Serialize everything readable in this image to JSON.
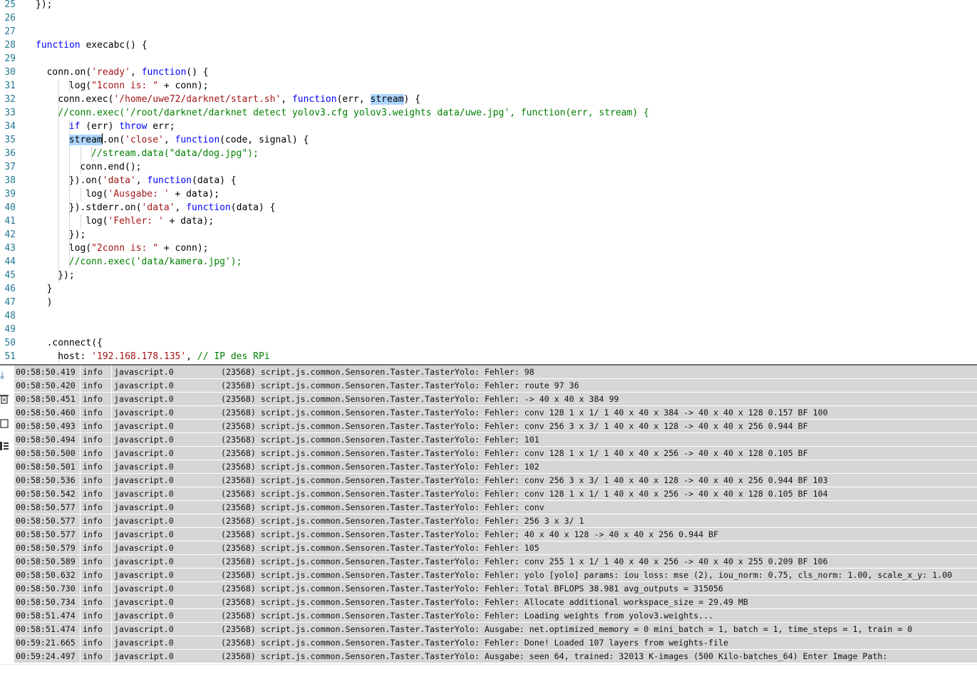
{
  "editor": {
    "lines": [
      {
        "n": "25",
        "ind": 0,
        "tokens": [
          {
            "t": "});"
          }
        ]
      },
      {
        "n": "26",
        "ind": 0,
        "tokens": []
      },
      {
        "n": "27",
        "ind": 0,
        "tokens": []
      },
      {
        "n": "28",
        "ind": 0,
        "tokens": [
          {
            "t": "function",
            "c": "kw"
          },
          {
            "t": " execabc() {"
          }
        ]
      },
      {
        "n": "29",
        "ind": 0,
        "tokens": []
      },
      {
        "n": "30",
        "ind": 2,
        "tokens": [
          {
            "t": "conn.on("
          },
          {
            "t": "'ready'",
            "c": "str"
          },
          {
            "t": ", "
          },
          {
            "t": "function",
            "c": "kw"
          },
          {
            "t": "() {"
          }
        ]
      },
      {
        "n": "31",
        "ind": 6,
        "tokens": [
          {
            "t": "log("
          },
          {
            "t": "\"1conn is: \"",
            "c": "str"
          },
          {
            "t": " + conn);"
          }
        ]
      },
      {
        "n": "32",
        "ind": 4,
        "tokens": [
          {
            "t": "conn.exec("
          },
          {
            "t": "'/home/uwe72/darknet/start.sh'",
            "c": "str"
          },
          {
            "t": ", "
          },
          {
            "t": "function",
            "c": "kw"
          },
          {
            "t": "(err, "
          },
          {
            "t": "stream",
            "c": "hl"
          },
          {
            "t": ") {"
          }
        ]
      },
      {
        "n": "33",
        "ind": 4,
        "tokens": [
          {
            "t": "//conn.exec('/root/darknet/darknet detect yolov3.cfg yolov3.weights data/uwe.jpg', function(err, stream) {",
            "c": "cmt"
          }
        ]
      },
      {
        "n": "34",
        "ind": 6,
        "tokens": [
          {
            "t": "if",
            "c": "kw"
          },
          {
            "t": " (err) "
          },
          {
            "t": "throw",
            "c": "kw"
          },
          {
            "t": " err;"
          }
        ]
      },
      {
        "n": "35",
        "ind": 6,
        "tokens": [
          {
            "t": "stream",
            "c": "hl"
          },
          {
            "t": "|",
            "c": "cur"
          },
          {
            "t": ".on("
          },
          {
            "t": "'close'",
            "c": "str"
          },
          {
            "t": ", "
          },
          {
            "t": "function",
            "c": "kw"
          },
          {
            "t": "(code, signal) {"
          }
        ]
      },
      {
        "n": "36",
        "ind": 10,
        "tokens": [
          {
            "t": "//stream.data(\"data/dog.jpg\");",
            "c": "cmt"
          }
        ]
      },
      {
        "n": "37",
        "ind": 8,
        "tokens": [
          {
            "t": "conn.end();"
          }
        ]
      },
      {
        "n": "38",
        "ind": 6,
        "tokens": [
          {
            "t": "}).on("
          },
          {
            "t": "'data'",
            "c": "str"
          },
          {
            "t": ", "
          },
          {
            "t": "function",
            "c": "kw"
          },
          {
            "t": "(data) {"
          }
        ]
      },
      {
        "n": "39",
        "ind": 9,
        "tokens": [
          {
            "t": "log("
          },
          {
            "t": "'Ausgabe: '",
            "c": "str"
          },
          {
            "t": " + data);"
          }
        ]
      },
      {
        "n": "40",
        "ind": 6,
        "tokens": [
          {
            "t": "}).stderr.on("
          },
          {
            "t": "'data'",
            "c": "str"
          },
          {
            "t": ", "
          },
          {
            "t": "function",
            "c": "kw"
          },
          {
            "t": "(data) {"
          }
        ]
      },
      {
        "n": "41",
        "ind": 9,
        "tokens": [
          {
            "t": "log("
          },
          {
            "t": "'Fehler: '",
            "c": "str"
          },
          {
            "t": " + data);"
          }
        ]
      },
      {
        "n": "42",
        "ind": 6,
        "tokens": [
          {
            "t": "});"
          }
        ]
      },
      {
        "n": "43",
        "ind": 6,
        "tokens": [
          {
            "t": "log("
          },
          {
            "t": "\"2conn is: \"",
            "c": "str"
          },
          {
            "t": " + conn);"
          }
        ]
      },
      {
        "n": "44",
        "ind": 6,
        "tokens": [
          {
            "t": "//conn.exec('data/kamera.jpg');",
            "c": "cmt"
          }
        ]
      },
      {
        "n": "45",
        "ind": 4,
        "tokens": [
          {
            "t": "});"
          }
        ]
      },
      {
        "n": "46",
        "ind": 2,
        "tokens": [
          {
            "t": "}"
          }
        ]
      },
      {
        "n": "47",
        "ind": 2,
        "tokens": [
          {
            "t": ")"
          }
        ]
      },
      {
        "n": "48",
        "ind": 0,
        "tokens": []
      },
      {
        "n": "49",
        "ind": 0,
        "tokens": []
      },
      {
        "n": "50",
        "ind": 2,
        "tokens": [
          {
            "t": ".connect({"
          }
        ]
      },
      {
        "n": "51",
        "ind": 4,
        "tokens": [
          {
            "t": "host: "
          },
          {
            "t": "'192.168.178.135'",
            "c": "str"
          },
          {
            "t": ", "
          },
          {
            "t": "// IP des RPi",
            "c": "cmt"
          }
        ]
      }
    ]
  },
  "log": {
    "toolbar_icons": [
      "scroll-down-icon",
      "delete-icon",
      "copy-icon",
      "list-icon"
    ],
    "rows": [
      {
        "time": "00:58:50.419",
        "level": "info",
        "source": "javascript.0",
        "msg": "(23568) script.js.common.Sensoren.Taster.TasterYolo: Fehler: 98"
      },
      {
        "time": "00:58:50.420",
        "level": "info",
        "source": "javascript.0",
        "msg": "(23568) script.js.common.Sensoren.Taster.TasterYolo: Fehler: route 97 36"
      },
      {
        "time": "00:58:50.451",
        "level": "info",
        "source": "javascript.0",
        "msg": "(23568) script.js.common.Sensoren.Taster.TasterYolo: Fehler: -> 40 x 40 x 384 99"
      },
      {
        "time": "00:58:50.460",
        "level": "info",
        "source": "javascript.0",
        "msg": "(23568) script.js.common.Sensoren.Taster.TasterYolo: Fehler: conv 128 1 x 1/ 1 40 x 40 x 384 -> 40 x 40 x 128 0.157 BF 100"
      },
      {
        "time": "00:58:50.493",
        "level": "info",
        "source": "javascript.0",
        "msg": "(23568) script.js.common.Sensoren.Taster.TasterYolo: Fehler: conv 256 3 x 3/ 1 40 x 40 x 128 -> 40 x 40 x 256 0.944 BF"
      },
      {
        "time": "00:58:50.494",
        "level": "info",
        "source": "javascript.0",
        "msg": "(23568) script.js.common.Sensoren.Taster.TasterYolo: Fehler: 101"
      },
      {
        "time": "00:58:50.500",
        "level": "info",
        "source": "javascript.0",
        "msg": "(23568) script.js.common.Sensoren.Taster.TasterYolo: Fehler: conv 128 1 x 1/ 1 40 x 40 x 256 -> 40 x 40 x 128 0.105 BF"
      },
      {
        "time": "00:58:50.501",
        "level": "info",
        "source": "javascript.0",
        "msg": "(23568) script.js.common.Sensoren.Taster.TasterYolo: Fehler: 102"
      },
      {
        "time": "00:58:50.536",
        "level": "info",
        "source": "javascript.0",
        "msg": "(23568) script.js.common.Sensoren.Taster.TasterYolo: Fehler: conv 256 3 x 3/ 1 40 x 40 x 128 -> 40 x 40 x 256 0.944 BF 103"
      },
      {
        "time": "00:58:50.542",
        "level": "info",
        "source": "javascript.0",
        "msg": "(23568) script.js.common.Sensoren.Taster.TasterYolo: Fehler: conv 128 1 x 1/ 1 40 x 40 x 256 -> 40 x 40 x 128 0.105 BF 104"
      },
      {
        "time": "00:58:50.577",
        "level": "info",
        "source": "javascript.0",
        "msg": "(23568) script.js.common.Sensoren.Taster.TasterYolo: Fehler: conv"
      },
      {
        "time": "00:58:50.577",
        "level": "info",
        "source": "javascript.0",
        "msg": "(23568) script.js.common.Sensoren.Taster.TasterYolo: Fehler: 256 3 x 3/ 1"
      },
      {
        "time": "00:58:50.577",
        "level": "info",
        "source": "javascript.0",
        "msg": "(23568) script.js.common.Sensoren.Taster.TasterYolo: Fehler: 40 x 40 x 128 -> 40 x 40 x 256 0.944 BF"
      },
      {
        "time": "00:58:50.579",
        "level": "info",
        "source": "javascript.0",
        "msg": "(23568) script.js.common.Sensoren.Taster.TasterYolo: Fehler: 105"
      },
      {
        "time": "00:58:50.589",
        "level": "info",
        "source": "javascript.0",
        "msg": "(23568) script.js.common.Sensoren.Taster.TasterYolo: Fehler: conv 255 1 x 1/ 1 40 x 40 x 256 -> 40 x 40 x 255 0.209 BF 106"
      },
      {
        "time": "00:58:50.632",
        "level": "info",
        "source": "javascript.0",
        "msg": "(23568) script.js.common.Sensoren.Taster.TasterYolo: Fehler: yolo [yolo] params: iou loss: mse (2), iou_norm: 0.75, cls_norm: 1.00, scale_x_y: 1.00"
      },
      {
        "time": "00:58:50.730",
        "level": "info",
        "source": "javascript.0",
        "msg": "(23568) script.js.common.Sensoren.Taster.TasterYolo: Fehler: Total BFLOPS 38.981 avg_outputs = 315056"
      },
      {
        "time": "00:58:50.734",
        "level": "info",
        "source": "javascript.0",
        "msg": "(23568) script.js.common.Sensoren.Taster.TasterYolo: Fehler: Allocate additional workspace_size = 29.49 MB"
      },
      {
        "time": "00:58:51.474",
        "level": "info",
        "source": "javascript.0",
        "msg": "(23568) script.js.common.Sensoren.Taster.TasterYolo: Fehler: Loading weights from yolov3.weights..."
      },
      {
        "time": "00:58:51.474",
        "level": "info",
        "source": "javascript.0",
        "msg": "(23568) script.js.common.Sensoren.Taster.TasterYolo: Ausgabe: net.optimized_memory = 0 mini_batch = 1, batch = 1, time_steps = 1, train = 0"
      },
      {
        "time": "00:59:21.665",
        "level": "info",
        "source": "javascript.0",
        "msg": "(23568) script.js.common.Sensoren.Taster.TasterYolo: Fehler: Done! Loaded 107 layers from weights-file"
      },
      {
        "time": "00:59:24.497",
        "level": "info",
        "source": "javascript.0",
        "msg": "(23568) script.js.common.Sensoren.Taster.TasterYolo: Ausgabe: seen 64, trained: 32013 K-images (500 Kilo-batches_64) Enter Image Path:"
      }
    ]
  }
}
